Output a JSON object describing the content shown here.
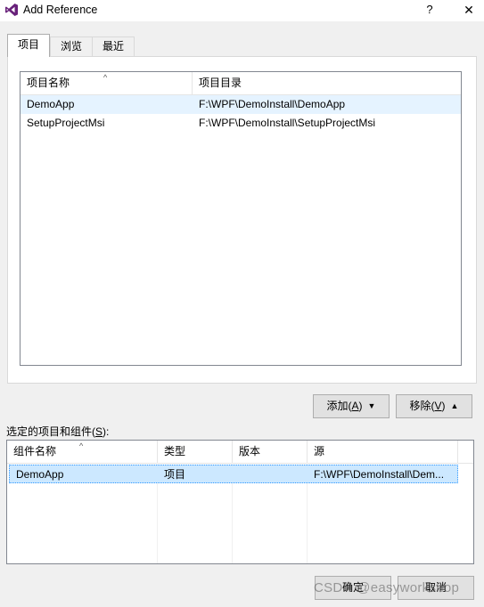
{
  "window": {
    "title": "Add Reference",
    "help_label": "?",
    "close_label": "✕"
  },
  "tabs": [
    {
      "label": "项目",
      "active": true
    },
    {
      "label": "浏览",
      "active": false
    },
    {
      "label": "最近",
      "active": false
    }
  ],
  "projects_list": {
    "columns": [
      "项目名称",
      "项目目录"
    ],
    "sort_indicator": "^",
    "rows": [
      {
        "name": "DemoApp",
        "path": "F:\\WPF\\DemoInstall\\DemoApp"
      },
      {
        "name": "SetupProjectMsi",
        "path": "F:\\WPF\\DemoInstall\\SetupProjectMsi"
      }
    ]
  },
  "buttons": {
    "add_prefix": "添加(",
    "add_key": "A",
    "add_suffix": ")",
    "remove_prefix": "移除(",
    "remove_key": "V",
    "remove_suffix": ")",
    "ok": "确定",
    "cancel": "取消"
  },
  "selected_section": {
    "label_prefix": "选定的项目和组件(",
    "label_key": "S",
    "label_suffix": "):"
  },
  "selected_list": {
    "columns": [
      "组件名称",
      "类型",
      "版本",
      "源"
    ],
    "sort_indicator": "^",
    "rows": [
      {
        "name": "DemoApp",
        "type": "项目",
        "version": "",
        "source": "F:\\WPF\\DemoInstall\\Dem..."
      }
    ]
  },
  "watermark": "CSDN @easyworkshop",
  "colors": {
    "selection": "#cce8ff",
    "hover": "#e5f3ff",
    "logo": "#68217a"
  }
}
